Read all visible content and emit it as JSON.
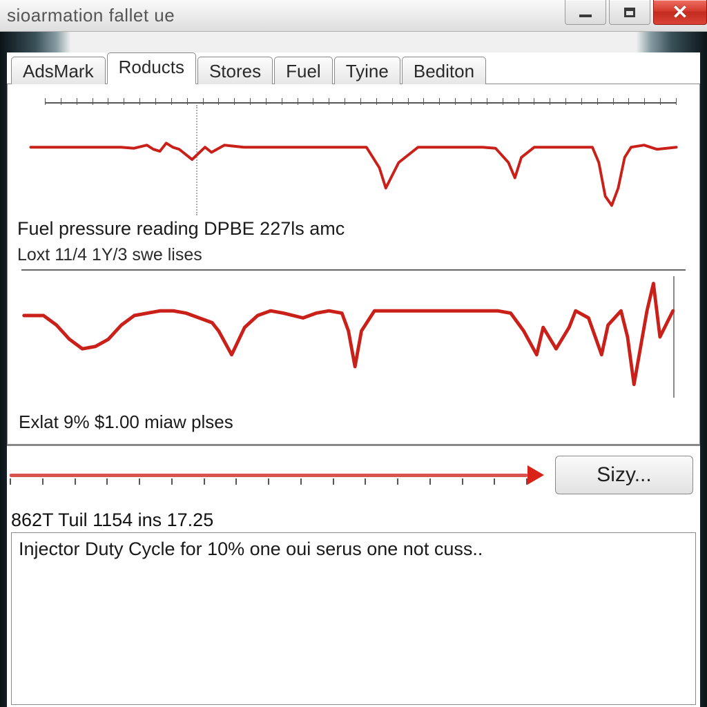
{
  "window": {
    "title": "sioarmation fallet ue"
  },
  "tabs": {
    "items": [
      "AdsMark",
      "Roducts",
      "Stores",
      "Fuel",
      "Tyine",
      "Bediton"
    ],
    "active_index": 1
  },
  "chart1": {
    "label": "Fuel pressure reading DPBE 227ls amc",
    "cursor_x_pct": 24
  },
  "chart2": {
    "header": "Loxt 11/4 1Y/3 swe lises",
    "footer": "Exlat 9%  $1.00 miaw plses"
  },
  "sizy_button": "Sizy...",
  "metric_line": "862T Tuil 1154 ins 17.25",
  "description": "Injector Duty Cycle for 10% one oui serus one not cuss..",
  "chart_data": [
    {
      "type": "line",
      "title": "Fuel pressure reading DPBE 227ls amc",
      "x": [
        0,
        2,
        4,
        6,
        8,
        10,
        12,
        14,
        16,
        18,
        19,
        20,
        21,
        22,
        23,
        25,
        27,
        28,
        30,
        33,
        35,
        38,
        40,
        45,
        50,
        52,
        54,
        55,
        57,
        60,
        65,
        70,
        72,
        74,
        75,
        76,
        78,
        82,
        85,
        87,
        88,
        89,
        90,
        91,
        92,
        93,
        95,
        97,
        100
      ],
      "values": [
        60,
        60,
        60,
        60,
        60,
        60,
        60,
        60,
        59,
        62,
        58,
        56,
        64,
        60,
        58,
        48,
        60,
        55,
        62,
        60,
        60,
        60,
        60,
        60,
        60,
        60,
        40,
        20,
        45,
        60,
        60,
        60,
        59,
        45,
        30,
        50,
        60,
        60,
        60,
        60,
        45,
        12,
        3,
        20,
        50,
        60,
        62,
        58,
        60
      ],
      "ylim": [
        0,
        100
      ],
      "xlabel": "",
      "ylabel": ""
    },
    {
      "type": "line",
      "title": "Loxt 11/4 1Y/3 swe lises",
      "x": [
        0,
        3,
        5,
        7,
        9,
        11,
        13,
        15,
        17,
        19,
        21,
        23,
        25,
        27,
        29,
        30,
        32,
        34,
        36,
        38,
        40,
        43,
        45,
        47,
        49,
        50,
        51,
        52,
        54,
        57,
        60,
        63,
        66,
        70,
        73,
        75,
        77,
        79,
        80,
        82,
        84,
        85,
        87,
        89,
        90,
        92,
        93,
        94,
        96,
        97,
        98,
        100
      ],
      "values": [
        68,
        68,
        60,
        48,
        40,
        42,
        48,
        60,
        68,
        70,
        72,
        72,
        70,
        66,
        62,
        55,
        35,
        58,
        68,
        72,
        70,
        66,
        70,
        72,
        70,
        55,
        25,
        55,
        72,
        72,
        72,
        72,
        72,
        72,
        72,
        70,
        55,
        35,
        58,
        40,
        58,
        72,
        66,
        35,
        60,
        72,
        50,
        10,
        72,
        95,
        50,
        72
      ],
      "ylim": [
        0,
        100
      ],
      "xlabel": "",
      "ylabel": ""
    }
  ]
}
